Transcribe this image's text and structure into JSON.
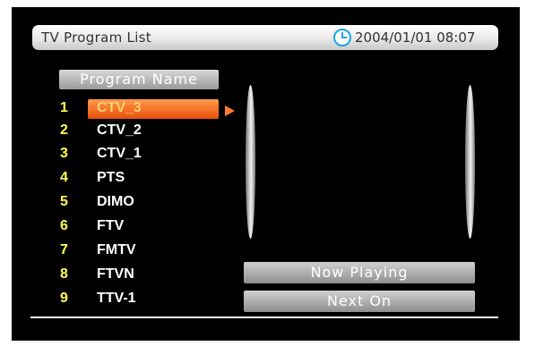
{
  "header": {
    "title": "TV Program List",
    "datetime": "2004/01/01 08:07"
  },
  "program_list": {
    "column_header": "Program Name",
    "selected_index": 0,
    "items": [
      {
        "number": "1",
        "name": "CTV_3"
      },
      {
        "number": "2",
        "name": "CTV_2"
      },
      {
        "number": "3",
        "name": "CTV_1"
      },
      {
        "number": "4",
        "name": "PTS"
      },
      {
        "number": "5",
        "name": "DIMO"
      },
      {
        "number": "6",
        "name": "FTV"
      },
      {
        "number": "7",
        "name": "FMTV"
      },
      {
        "number": "8",
        "name": "FTVN"
      },
      {
        "number": "9",
        "name": "TTV-1"
      }
    ]
  },
  "info": {
    "now_playing_label": "Now Playing",
    "next_on_label": "Next On"
  },
  "icons": {
    "clock": "clock-icon",
    "selection_arrow": "triangle-right-icon"
  },
  "colors": {
    "highlight": "#f2661e",
    "number_text": "#ffff55",
    "clock_accent": "#1aa6e6",
    "background": "#000000"
  }
}
